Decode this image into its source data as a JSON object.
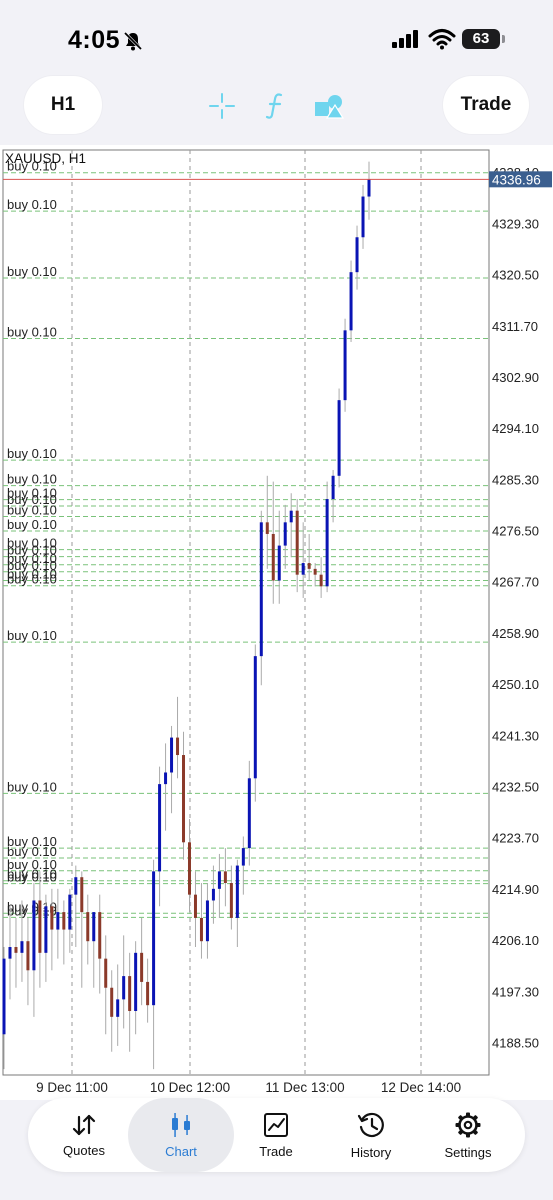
{
  "status": {
    "time": "4:05",
    "battery": "63"
  },
  "toolbar": {
    "timeframe": "H1",
    "trade": "Trade",
    "icons": [
      "crosshair-icon",
      "indicators-f-icon",
      "objects-shapes-icon"
    ]
  },
  "chart_data": {
    "type": "candlestick",
    "symbol_label": "XAUUSD, H1",
    "current_price": "4336.96",
    "ylim": [
      4183,
      4342
    ],
    "y_ticks": [
      "4338.10",
      "4329.30",
      "4320.50",
      "4311.70",
      "4302.90",
      "4294.10",
      "4285.30",
      "4276.50",
      "4267.70",
      "4258.90",
      "4250.10",
      "4241.30",
      "4232.50",
      "4223.70",
      "4214.90",
      "4206.10",
      "4197.30",
      "4188.50"
    ],
    "x_ticks": [
      "9 Dec 11:00",
      "10 Dec 12:00",
      "11 Dec 13:00",
      "12 Dec 14:00"
    ],
    "order_label": "buy 0.10",
    "order_levels": [
      4338.1,
      4331.5,
      4320.0,
      4309.6,
      4288.7,
      4284.3,
      4281.9,
      4280.8,
      4279.0,
      4276.5,
      4273.3,
      4272.1,
      4270.7,
      4269.5,
      4268.0,
      4267.1,
      4257.4,
      4231.4,
      4222.0,
      4220.3,
      4218.1,
      4216.4,
      4215.9,
      4210.8,
      4210.1
    ],
    "candles": [
      {
        "o": 4190,
        "h": 4205,
        "l": 4184,
        "c": 4203
      },
      {
        "o": 4203,
        "h": 4212,
        "l": 4196,
        "c": 4205
      },
      {
        "o": 4205,
        "h": 4210,
        "l": 4198,
        "c": 4204
      },
      {
        "o": 4204,
        "h": 4213,
        "l": 4199,
        "c": 4206
      },
      {
        "o": 4206,
        "h": 4210,
        "l": 4195,
        "c": 4201
      },
      {
        "o": 4201,
        "h": 4216,
        "l": 4193,
        "c": 4213
      },
      {
        "o": 4213,
        "h": 4218,
        "l": 4198,
        "c": 4204
      },
      {
        "o": 4204,
        "h": 4214,
        "l": 4199,
        "c": 4212
      },
      {
        "o": 4212,
        "h": 4215,
        "l": 4201,
        "c": 4208
      },
      {
        "o": 4208,
        "h": 4215,
        "l": 4203,
        "c": 4211
      },
      {
        "o": 4211,
        "h": 4213,
        "l": 4202,
        "c": 4208
      },
      {
        "o": 4208,
        "h": 4215,
        "l": 4204,
        "c": 4214
      },
      {
        "o": 4214,
        "h": 4219,
        "l": 4205,
        "c": 4217
      },
      {
        "o": 4217,
        "h": 4218,
        "l": 4198,
        "c": 4211
      },
      {
        "o": 4211,
        "h": 4214,
        "l": 4202,
        "c": 4206
      },
      {
        "o": 4206,
        "h": 4211,
        "l": 4198,
        "c": 4211
      },
      {
        "o": 4211,
        "h": 4214,
        "l": 4197,
        "c": 4203
      },
      {
        "o": 4203,
        "h": 4207,
        "l": 4190,
        "c": 4198
      },
      {
        "o": 4198,
        "h": 4201,
        "l": 4187,
        "c": 4193
      },
      {
        "o": 4193,
        "h": 4202,
        "l": 4188,
        "c": 4196
      },
      {
        "o": 4196,
        "h": 4207,
        "l": 4191,
        "c": 4200
      },
      {
        "o": 4200,
        "h": 4204,
        "l": 4187,
        "c": 4194
      },
      {
        "o": 4194,
        "h": 4206,
        "l": 4190,
        "c": 4204
      },
      {
        "o": 4204,
        "h": 4210,
        "l": 4195,
        "c": 4199
      },
      {
        "o": 4199,
        "h": 4203,
        "l": 4192,
        "c": 4195
      },
      {
        "o": 4195,
        "h": 4220,
        "l": 4184,
        "c": 4218
      },
      {
        "o": 4218,
        "h": 4236,
        "l": 4212,
        "c": 4233
      },
      {
        "o": 4233,
        "h": 4240,
        "l": 4225,
        "c": 4235
      },
      {
        "o": 4235,
        "h": 4243,
        "l": 4228,
        "c": 4241
      },
      {
        "o": 4241,
        "h": 4248,
        "l": 4234,
        "c": 4238
      },
      {
        "o": 4238,
        "h": 4242,
        "l": 4220,
        "c": 4223
      },
      {
        "o": 4223,
        "h": 4227,
        "l": 4211,
        "c": 4214
      },
      {
        "o": 4214,
        "h": 4218,
        "l": 4205,
        "c": 4210
      },
      {
        "o": 4210,
        "h": 4216,
        "l": 4203,
        "c": 4206
      },
      {
        "o": 4206,
        "h": 4216,
        "l": 4203,
        "c": 4213
      },
      {
        "o": 4213,
        "h": 4219,
        "l": 4209,
        "c": 4215
      },
      {
        "o": 4215,
        "h": 4221,
        "l": 4210,
        "c": 4218
      },
      {
        "o": 4218,
        "h": 4222,
        "l": 4212,
        "c": 4216
      },
      {
        "o": 4216,
        "h": 4219,
        "l": 4208,
        "c": 4210
      },
      {
        "o": 4210,
        "h": 4220,
        "l": 4205,
        "c": 4219
      },
      {
        "o": 4219,
        "h": 4224,
        "l": 4214,
        "c": 4222
      },
      {
        "o": 4222,
        "h": 4237,
        "l": 4219,
        "c": 4234
      },
      {
        "o": 4234,
        "h": 4257,
        "l": 4230,
        "c": 4255
      },
      {
        "o": 4255,
        "h": 4280,
        "l": 4250,
        "c": 4278
      },
      {
        "o": 4278,
        "h": 4286,
        "l": 4270,
        "c": 4276
      },
      {
        "o": 4276,
        "h": 4285,
        "l": 4264,
        "c": 4268
      },
      {
        "o": 4268,
        "h": 4280,
        "l": 4264,
        "c": 4274
      },
      {
        "o": 4274,
        "h": 4281,
        "l": 4270,
        "c": 4278
      },
      {
        "o": 4278,
        "h": 4283,
        "l": 4272,
        "c": 4280
      },
      {
        "o": 4280,
        "h": 4282,
        "l": 4266,
        "c": 4269
      },
      {
        "o": 4269,
        "h": 4278,
        "l": 4265,
        "c": 4271
      },
      {
        "o": 4271,
        "h": 4276,
        "l": 4268,
        "c": 4270
      },
      {
        "o": 4270,
        "h": 4271,
        "l": 4267,
        "c": 4269
      },
      {
        "o": 4269,
        "h": 4272,
        "l": 4265,
        "c": 4267
      },
      {
        "o": 4267,
        "h": 4285,
        "l": 4266,
        "c": 4282
      },
      {
        "o": 4282,
        "h": 4287,
        "l": 4278,
        "c": 4286
      },
      {
        "o": 4286,
        "h": 4301,
        "l": 4284,
        "c": 4299
      },
      {
        "o": 4299,
        "h": 4313,
        "l": 4297,
        "c": 4311
      },
      {
        "o": 4311,
        "h": 4323,
        "l": 4309,
        "c": 4321
      },
      {
        "o": 4321,
        "h": 4329,
        "l": 4318,
        "c": 4327
      },
      {
        "o": 4327,
        "h": 4336,
        "l": 4325,
        "c": 4334
      },
      {
        "o": 4334,
        "h": 4340,
        "l": 4330,
        "c": 4337
      }
    ]
  },
  "nav": [
    {
      "label": "Quotes",
      "icon": "quotes-arrows-icon"
    },
    {
      "label": "Chart",
      "icon": "chart-candles-icon"
    },
    {
      "label": "Trade",
      "icon": "trade-chart-icon"
    },
    {
      "label": "History",
      "icon": "history-clock-icon"
    },
    {
      "label": "Settings",
      "icon": "settings-gear-icon"
    }
  ],
  "colors": {
    "bull": "#0a14b4",
    "bear": "#8b3a2a",
    "order_line": "#7ac27a",
    "price_line": "#d9534f",
    "price_badge": "#3b5f8f",
    "accent": "#2b7cd3",
    "tool_icon": "#6fd5ee"
  }
}
